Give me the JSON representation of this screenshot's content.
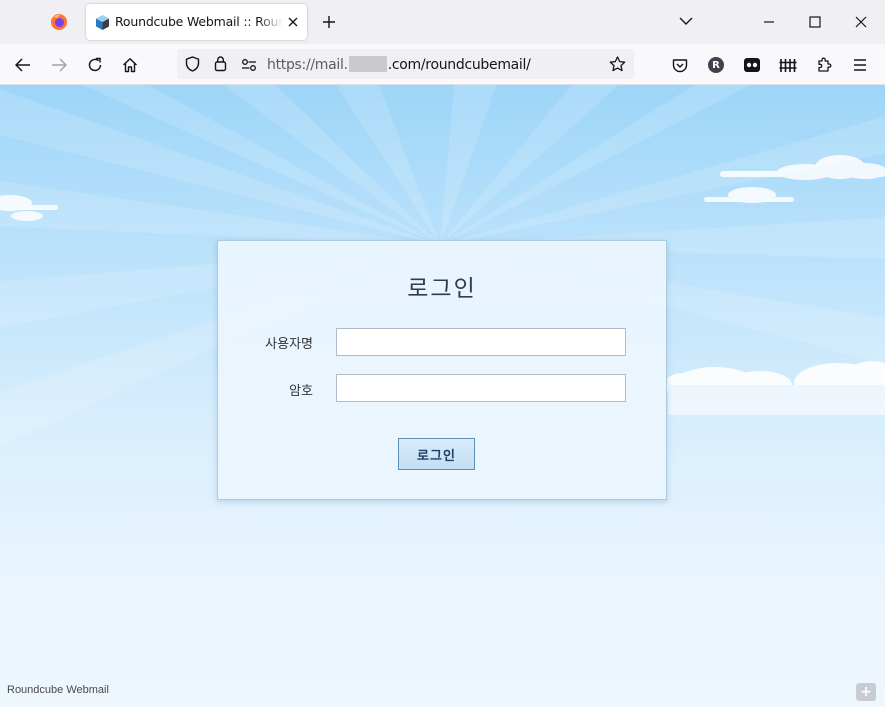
{
  "browser": {
    "tab": {
      "title": "Roundcube Webmail :: Roundcube Webmail",
      "favicon": "roundcube-cube-icon"
    },
    "url": {
      "prefix": "https://mail.",
      "suffix": ".com/roundcubemail/"
    },
    "profile_initial": "R",
    "accent": "#15141a"
  },
  "login": {
    "title": "로그인",
    "username_label": "사용자명",
    "password_label": "암호",
    "username_value": "",
    "password_value": "",
    "submit_label": "로그인"
  },
  "footer": {
    "brand": "Roundcube Webmail",
    "button_icon": "plus-icon"
  },
  "colors": {
    "sky_top": "#9dd5f8",
    "sky_bottom": "#eef7fe",
    "panel_border": "#a9cbe3",
    "button_border": "#5d8fb8"
  }
}
